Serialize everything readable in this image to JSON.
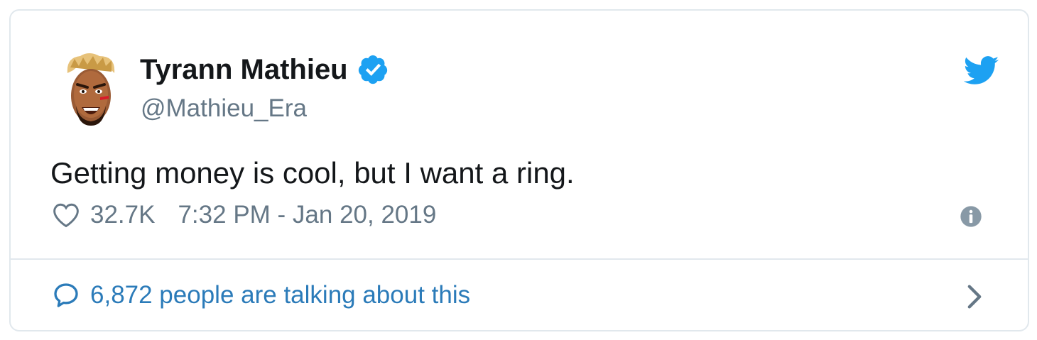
{
  "tweet": {
    "author": {
      "display_name": "Tyrann Mathieu",
      "handle": "@Mathieu_Era",
      "verified": true,
      "avatar": "cartoon-avatar"
    },
    "text": "Getting money is cool, but I want a ring.",
    "likes": "32.7K",
    "timestamp": "7:32 PM - Jan 20, 2019",
    "footer_text": "6,872 people are talking about this"
  },
  "icons": {
    "brand": "twitter-bird-icon",
    "verified": "verified-badge-icon",
    "like": "heart-icon",
    "info": "info-icon",
    "reply": "speech-bubble-icon",
    "chevron": "chevron-right-icon"
  },
  "colors": {
    "twitter_blue": "#1da1f2",
    "text_primary": "#14171a",
    "text_secondary": "#657786",
    "link": "#2b7bb9",
    "border": "#e1e8ed"
  }
}
